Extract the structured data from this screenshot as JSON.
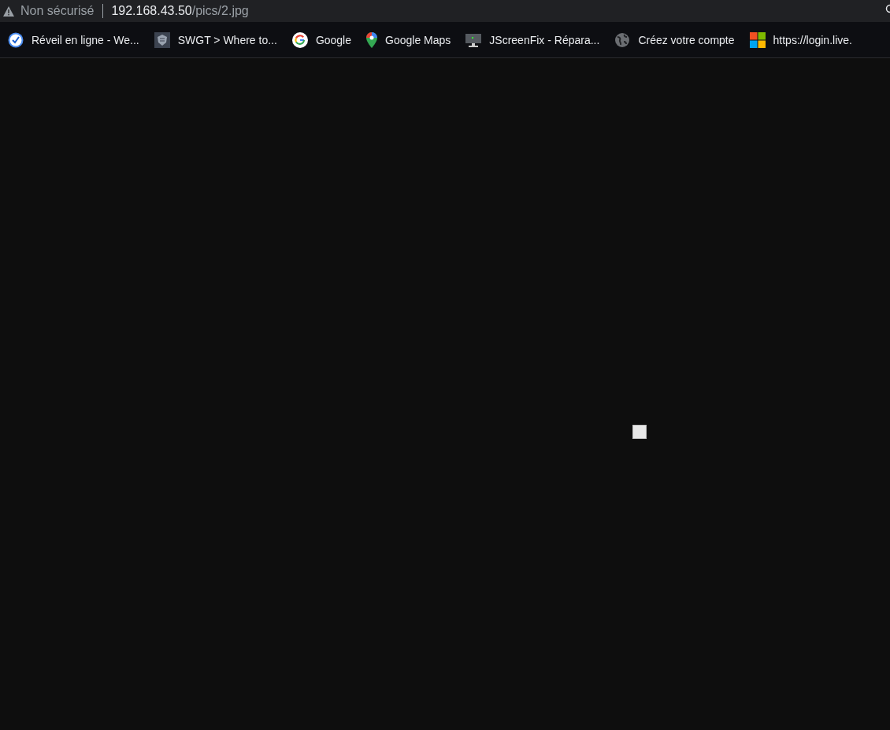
{
  "address_bar": {
    "security_label": "Non sécurisé",
    "url_host": "192.168.43.50",
    "url_path": "/pics/2.jpg"
  },
  "bookmarks": [
    {
      "kind": "clock",
      "label": "Réveil en ligne - We..."
    },
    {
      "kind": "shield",
      "label": "SWGT > Where to..."
    },
    {
      "kind": "google",
      "label": "Google"
    },
    {
      "kind": "maps",
      "label": "Google Maps"
    },
    {
      "kind": "monitor",
      "label": "JScreenFix - Répara..."
    },
    {
      "kind": "globe",
      "label": "Créez votre compte"
    },
    {
      "kind": "windows",
      "label": "https://login.live."
    }
  ]
}
